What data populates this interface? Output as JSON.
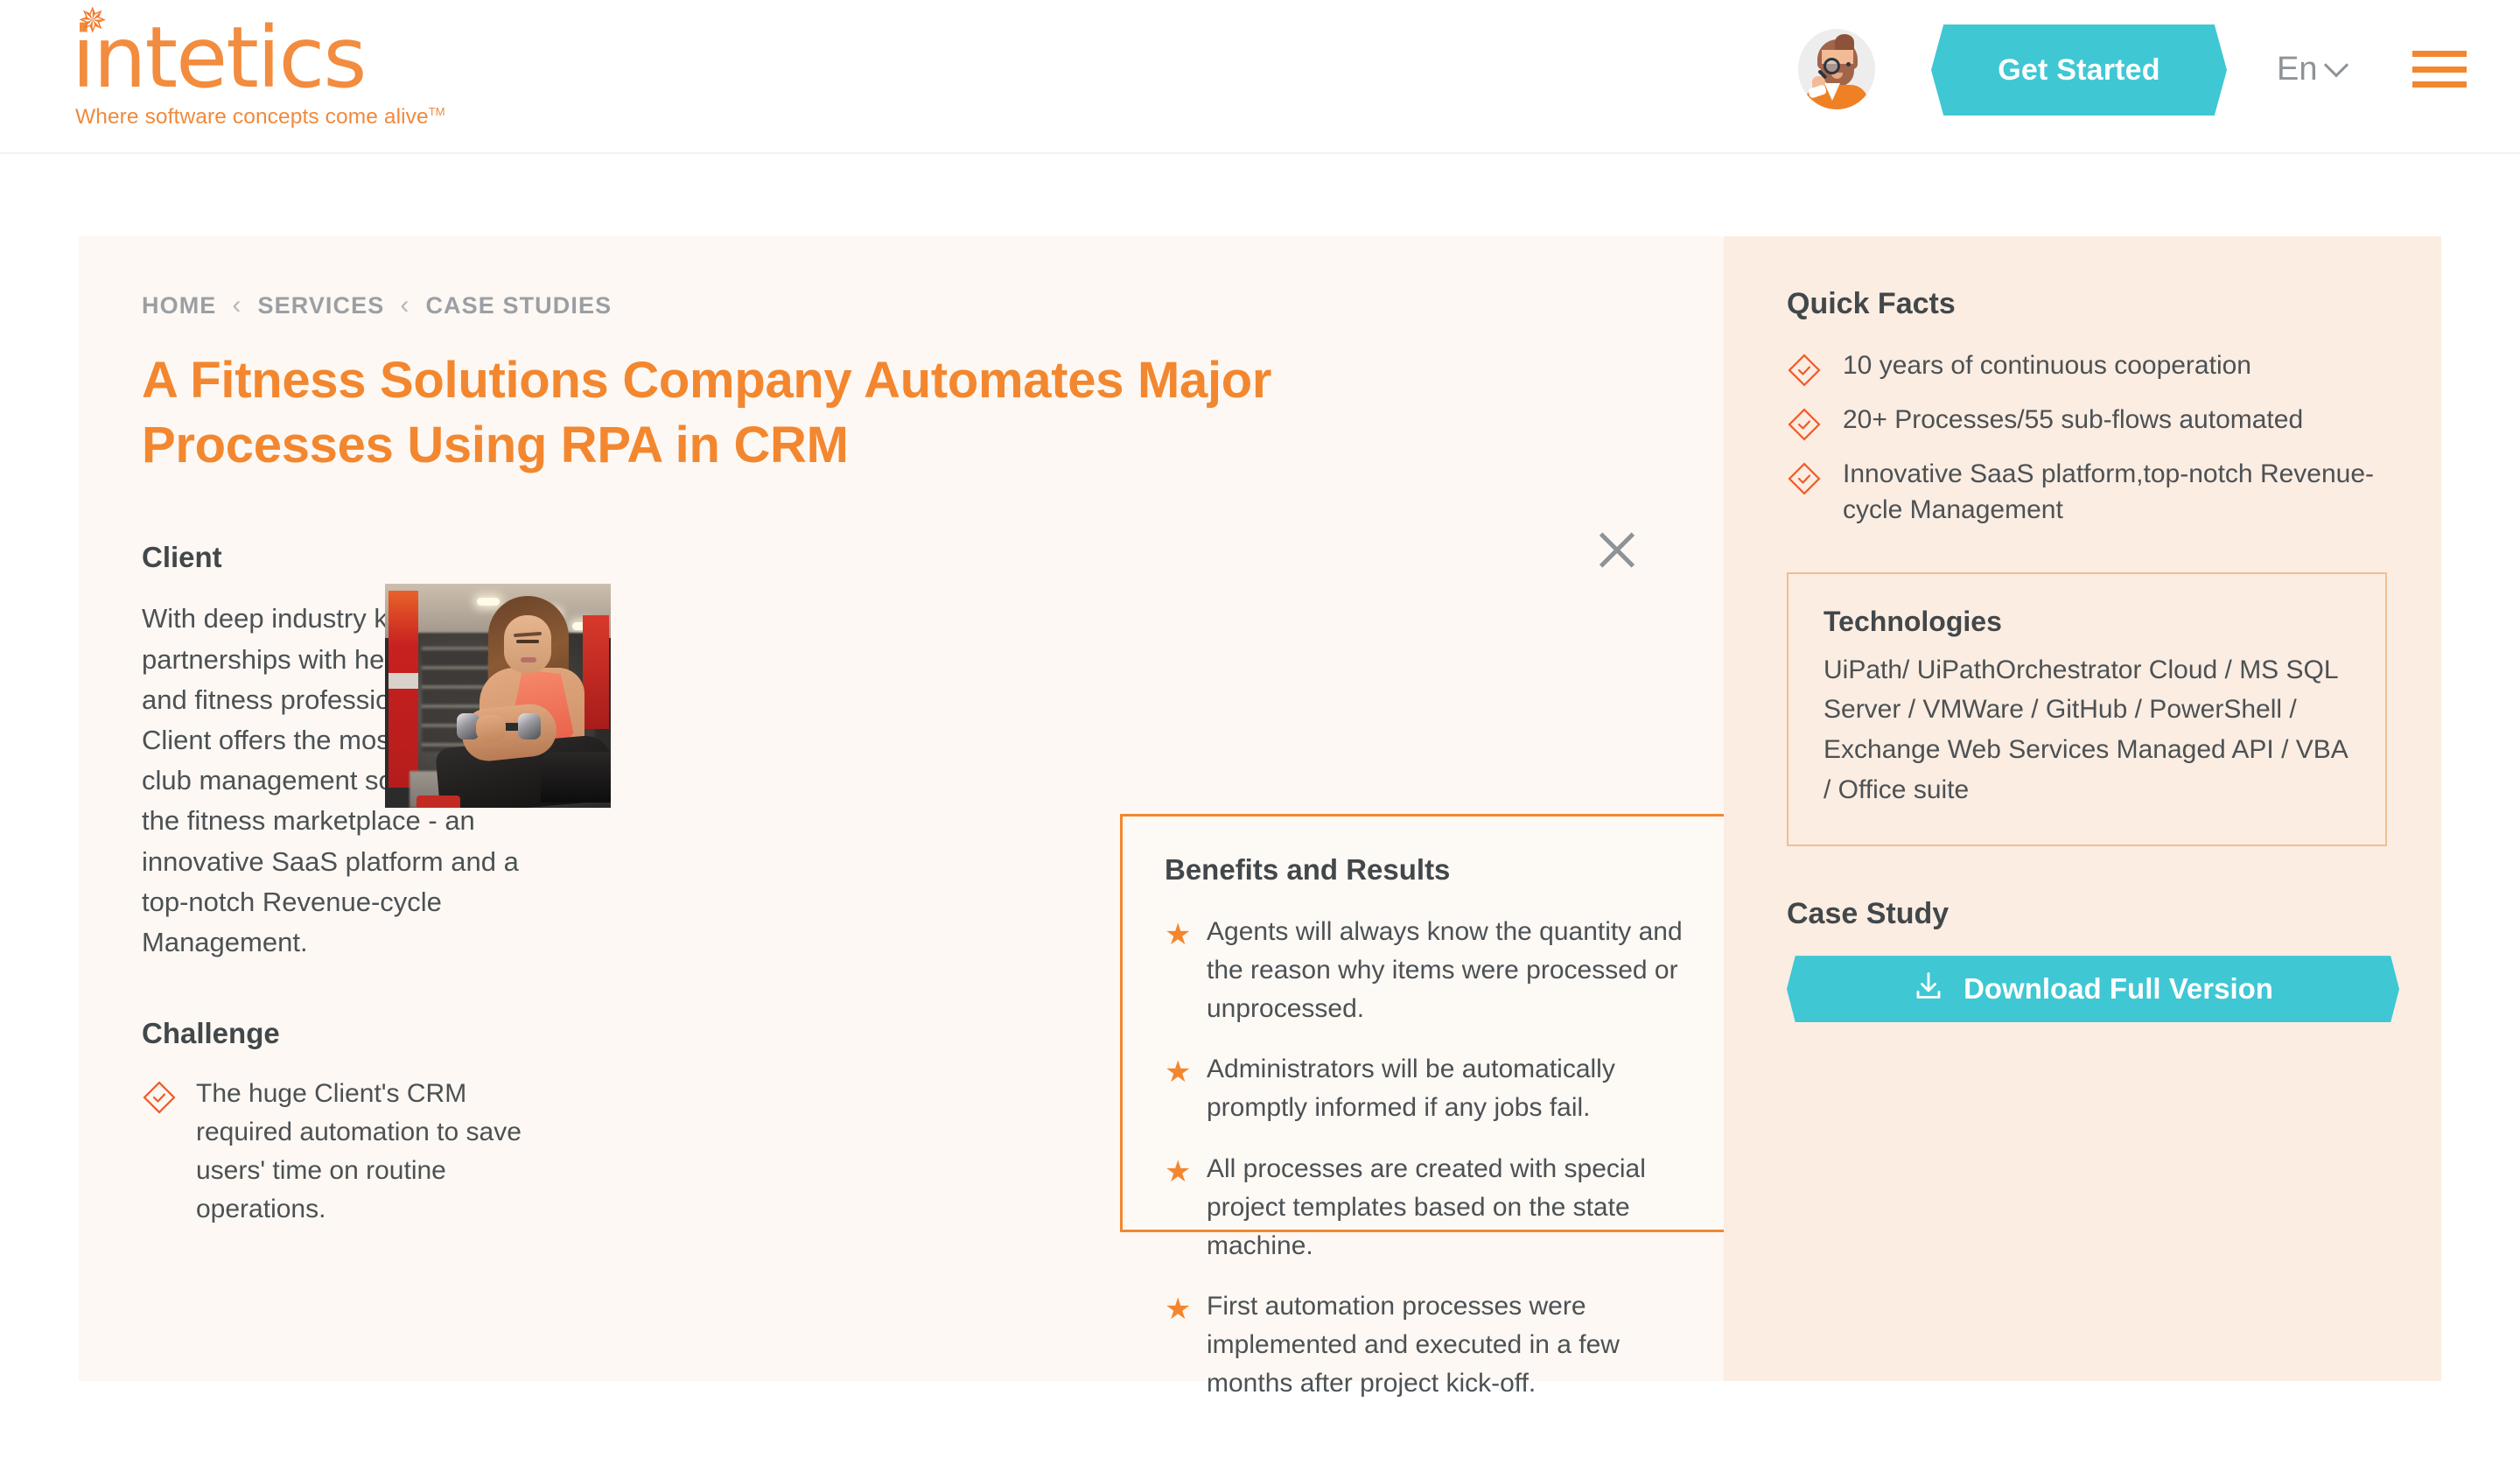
{
  "brand": {
    "logo_text": "intetics",
    "tagline": "Where software concepts come alive",
    "tagline_tm": "TM",
    "orange": "#F3872F",
    "teal": "#3FC7D4",
    "text_dark": "#4c5154"
  },
  "header": {
    "cta_label": "Get Started",
    "language": "En"
  },
  "breadcrumb": {
    "items": [
      "HOME",
      "SERVICES",
      "CASE STUDIES"
    ],
    "separator": "‹"
  },
  "case": {
    "title": "A Fitness Solutions Company Automates Major Processes Using RPA in CRM"
  },
  "client": {
    "heading": "Client",
    "text": "With deep industry knowledge, partnerships with health clubs and fitness professionals, the Client offers the most proven club management solution in the fitness marketplace - an innovative SaaS platform and a top-notch Revenue-cycle Management."
  },
  "challenge": {
    "heading": "Challenge",
    "items": [
      "The huge Client's CRM required automation to save users' time on routine operations."
    ]
  },
  "benefits": {
    "heading": "Benefits and Results",
    "bullet": "★",
    "items": [
      "Agents will always know the quantity and the reason why items were processed or unprocessed.",
      "Administrators will be automatically promptly informed if any jobs fail.",
      "All processes are created with special project templates based on the state machine.",
      "First automation processes were implemented and executed in a few months after project kick-off."
    ]
  },
  "quick_facts": {
    "heading": "Quick Facts",
    "items": [
      "10 years of continuous cooperation",
      "20+ Processes/55 sub-flows automated",
      "Innovative SaaS platform,top-notch Revenue-cycle Management"
    ]
  },
  "technologies": {
    "heading": "Technologies",
    "text": "UiPath/ UiPathOrchestrator Cloud / MS SQL Server / VMWare / GitHub / PowerShell / Exchange Web Services Managed API / VBA / Office suite"
  },
  "case_study": {
    "heading": "Case Study",
    "download_label": "Download Full Version"
  }
}
